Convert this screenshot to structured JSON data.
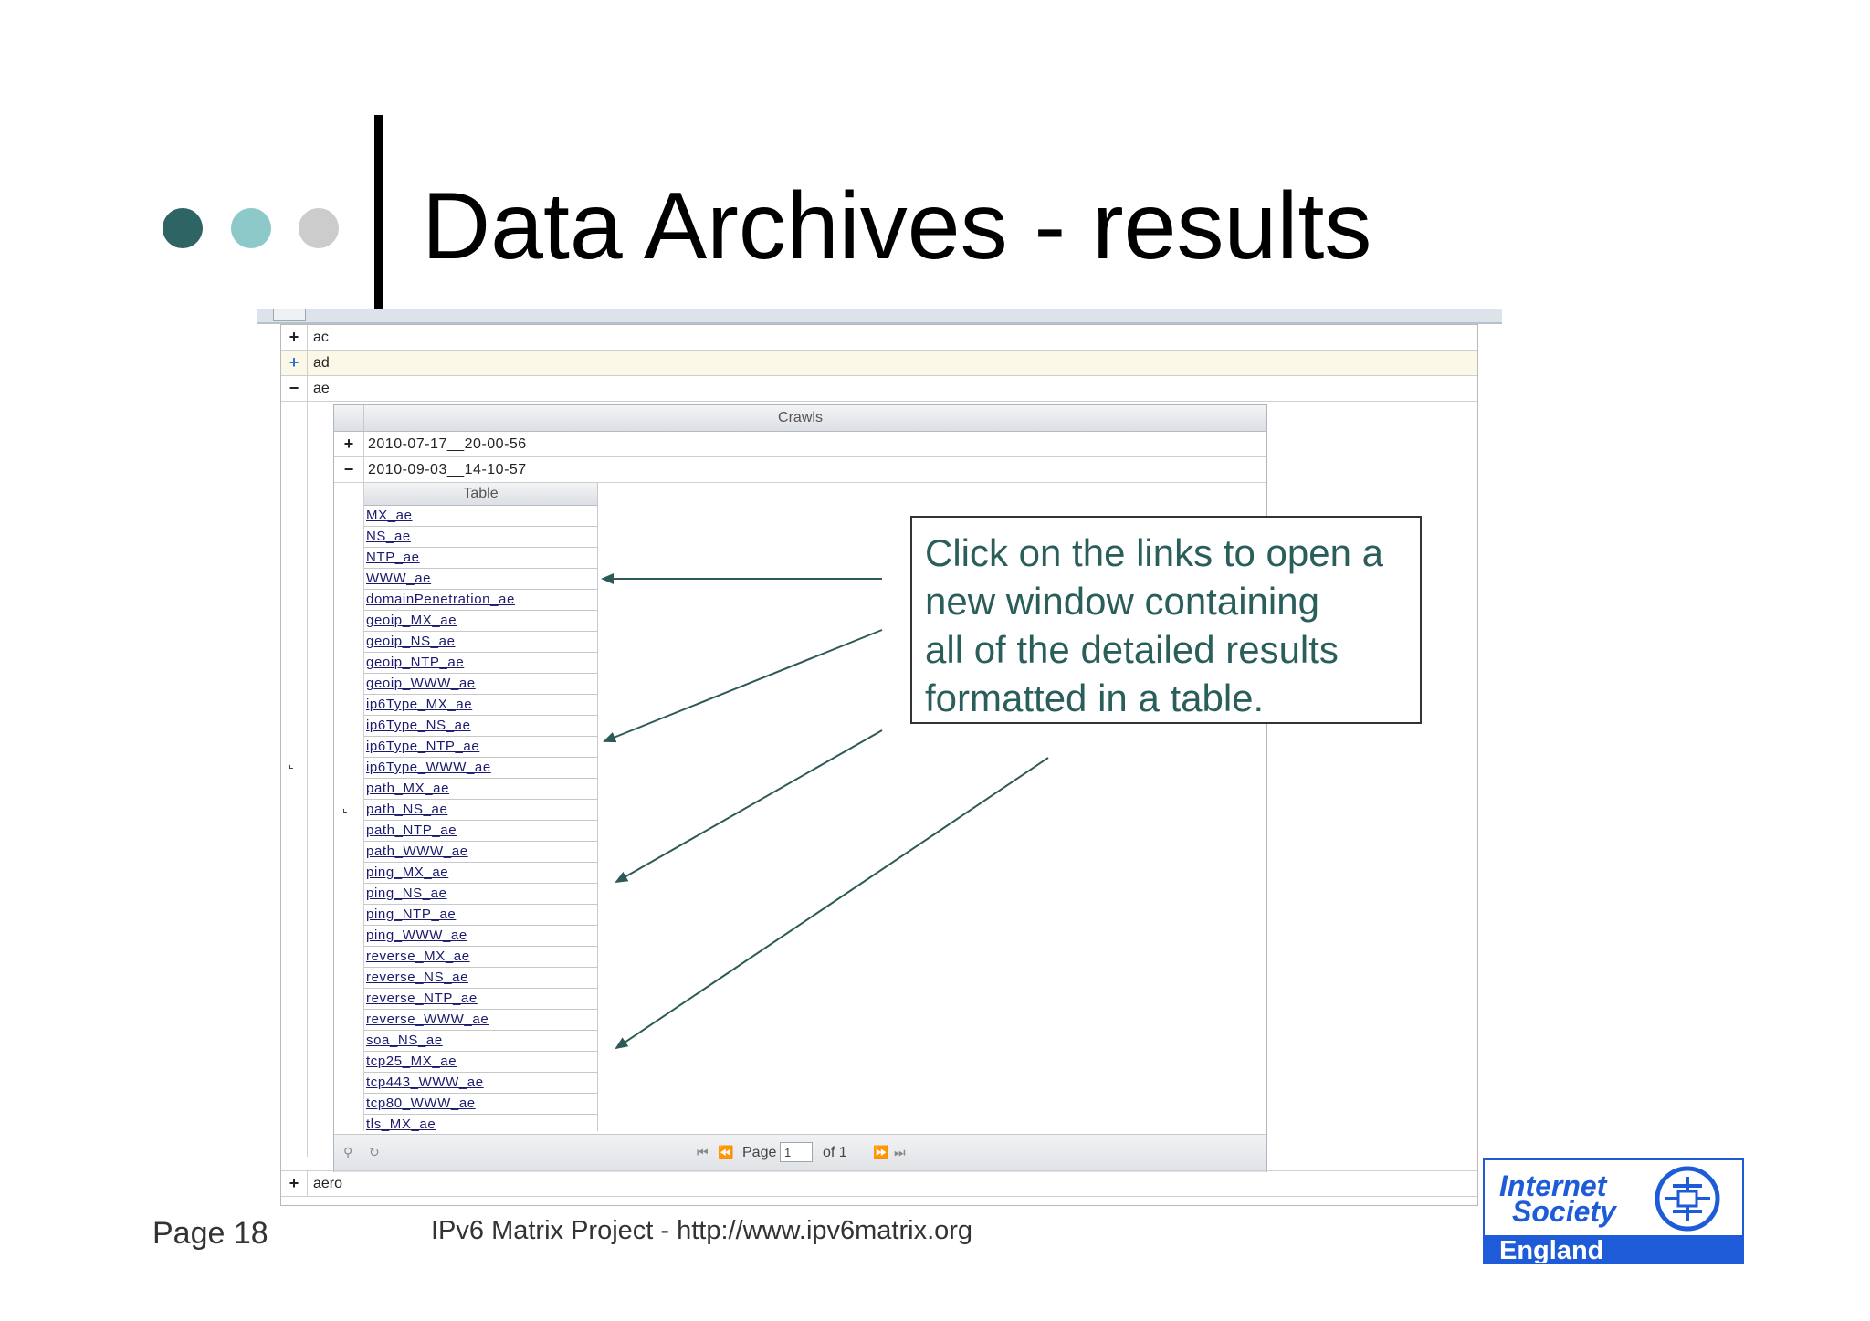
{
  "slide": {
    "title": "Data Archives - results",
    "page_label": "Page 18",
    "footer_project": "IPv6 Matrix Project - http://www.ipv6matrix.org"
  },
  "colors": {
    "dot_dark": "#2f6464",
    "dot_mid": "#8ec9c9",
    "dot_light": "#cccccc",
    "callout_text": "#2a5e5a",
    "logo_blue": "#1d5bd8"
  },
  "outer_tree": {
    "rows": [
      {
        "toggle": "+",
        "label": "ac"
      },
      {
        "toggle": "+",
        "label": "ad"
      },
      {
        "toggle": "−",
        "label": "ae"
      }
    ],
    "bottom_row": {
      "toggle": "+",
      "label": "aero"
    },
    "corner_glyph": "⌞"
  },
  "crawls": {
    "header": "Crawls",
    "rows": [
      {
        "toggle": "+",
        "label": "2010-07-17__20-00-56"
      },
      {
        "toggle": "−",
        "label": "2010-09-03__14-10-57"
      }
    ],
    "corner_glyph": "⌞",
    "table": {
      "header": "Table",
      "links": [
        "MX_ae",
        "NS_ae",
        "NTP_ae",
        "WWW_ae",
        "domainPenetration_ae",
        "geoip_MX_ae",
        "geoip_NS_ae",
        "geoip_NTP_ae",
        "geoip_WWW_ae",
        "ip6Type_MX_ae",
        "ip6Type_NS_ae",
        "ip6Type_NTP_ae",
        "ip6Type_WWW_ae",
        "path_MX_ae",
        "path_NS_ae",
        "path_NTP_ae",
        "path_WWW_ae",
        "ping_MX_ae",
        "ping_NS_ae",
        "ping_NTP_ae",
        "ping_WWW_ae",
        "reverse_MX_ae",
        "reverse_NS_ae",
        "reverse_NTP_ae",
        "reverse_WWW_ae",
        "soa_NS_ae",
        "tcp25_MX_ae",
        "tcp443_WWW_ae",
        "tcp80_WWW_ae",
        "tls_MX_ae"
      ]
    },
    "pager": {
      "page_label": "Page",
      "page_value": "1",
      "of_label": "of 1",
      "icons": [
        "search-icon",
        "refresh-icon",
        "first-page-icon",
        "prev-page-icon",
        "next-page-icon",
        "last-page-icon"
      ]
    }
  },
  "callout": {
    "lines": [
      "Click on the links to open a",
      "new window containing",
      "all of the detailed results",
      "formatted in a table."
    ]
  },
  "logo": {
    "line1": "Internet",
    "line2": "Society",
    "line3": "England"
  }
}
